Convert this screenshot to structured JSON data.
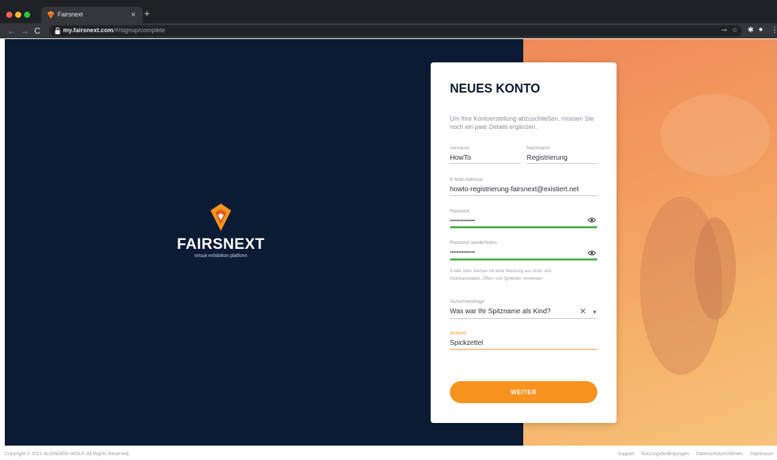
{
  "browser": {
    "tab_title": "Fairsnext",
    "tab_close": "×",
    "new_tab": "+",
    "url_host": "my.fairsnext.com",
    "url_path": "/#/signup/complete",
    "icons": [
      "back-icon",
      "forward-icon",
      "reload-icon",
      "lock-icon",
      "key-icon",
      "star-icon",
      "extensions-icon",
      "profile-icon",
      "menu-icon"
    ]
  },
  "brand": {
    "name": "FAIRSNEXT",
    "tagline": "virtual exhibition platform",
    "colors": {
      "navy": "#0c1b34",
      "orange": "#f7931e",
      "green": "#4caf50"
    }
  },
  "form": {
    "title": "NEUES KONTO",
    "intro": "Um Ihre Kontoerstellung abzuschließen, müssen Sie noch ein paar Details ergänzen.",
    "first_name": {
      "label": "Vorname",
      "value": "HowTo"
    },
    "last_name": {
      "label": "Nachname",
      "value": "Registrierung"
    },
    "email": {
      "label": "E-Mail-Adresse",
      "value": "howto-registrierung-fairsnext@existiert.net"
    },
    "password": {
      "label": "Passwort",
      "value": "•••••••••••••••"
    },
    "password_repeat": {
      "label": "Passwort wiederholen",
      "value": "•••••••••••••••"
    },
    "password_hint": "8 oder mehr Zeichen mit einer Mischung aus Groß- und Kleinbuchstaben, Ziffern und Symbolen verwenden",
    "security_question": {
      "label": "Sicherheitsfrage",
      "value": "Was war Ihr Spitzname als Kind?",
      "clear": "✕",
      "caret": "▼"
    },
    "answer": {
      "label": "Antwort",
      "value": "Spickzettel"
    },
    "submit": "WEITER"
  },
  "footer": {
    "copyright": "Copyright © 2021 ALDINGER+WOLF. All Rights Reserved.",
    "links": [
      "Support",
      "Nutzungsbedingungen",
      "Datenschutzrichtlinien",
      "Impressum"
    ]
  }
}
